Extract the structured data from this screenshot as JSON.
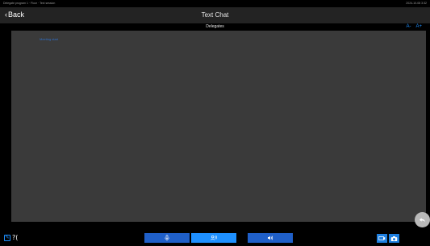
{
  "status_bar": {
    "left_text": "Delegate program 1 · Floor · Text session",
    "right_text": "2024-10-08 3:32"
  },
  "header": {
    "back_label": "Back",
    "title": "Text Chat",
    "subtitle": "Delegates"
  },
  "font_controls": {
    "decrease_label": "A-",
    "increase_label": "A+"
  },
  "chat": {
    "messages": [
      {
        "text": "Meeting start"
      }
    ]
  },
  "footer": {
    "lang_label": "?("
  },
  "colors": {
    "accent": "#1e90ff",
    "button_blue": "#1f5fc8",
    "panel_bg": "#3a3a3a",
    "header_bg": "#232323"
  },
  "icons": {
    "mic": "microphone-icon",
    "speech": "speech-icon",
    "speaker": "speaker-icon",
    "reply": "reply-icon",
    "camera": "camera-icon",
    "screen": "screen-share-icon"
  }
}
